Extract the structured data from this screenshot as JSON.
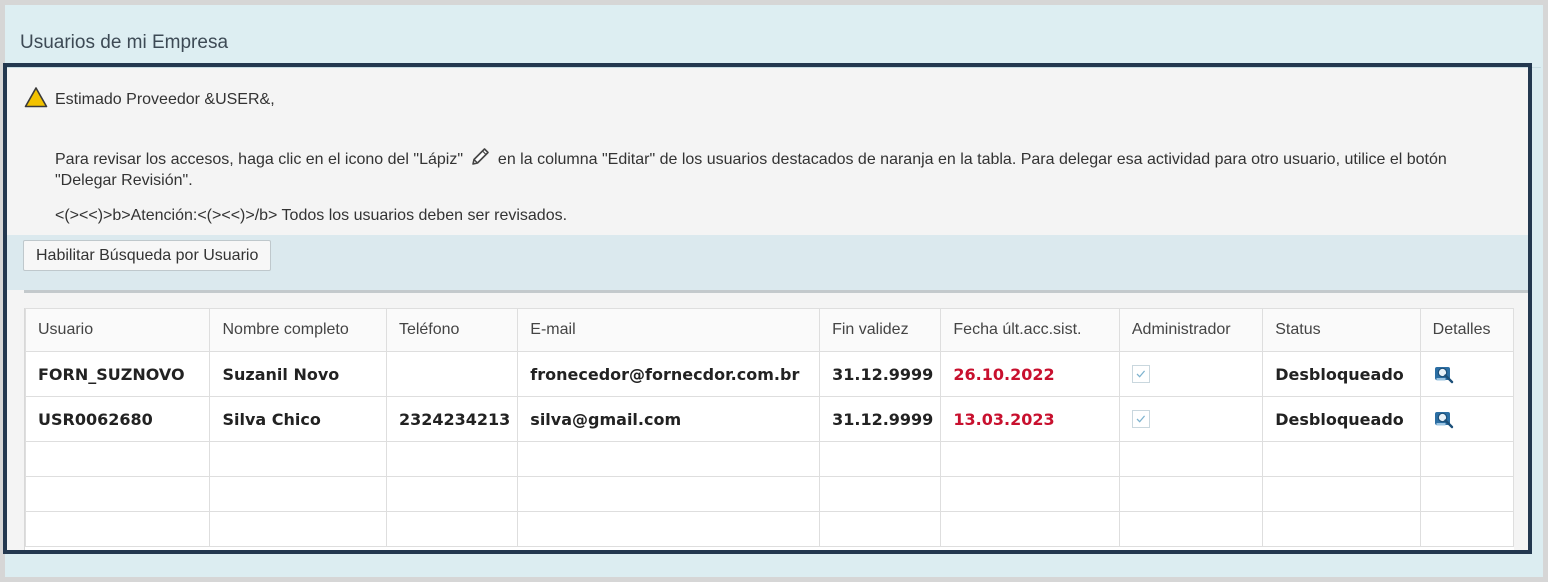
{
  "panel": {
    "title": "Usuarios de mi Empresa"
  },
  "message": {
    "greeting": "Estimado Proveedor &USER&,",
    "paragraph_before": "Para revisar los accesos, haga clic en el icono del \"Lápiz\"",
    "paragraph_after": "en la columna \"Editar\" de los usuarios destacados de naranja en la tabla. Para delegar esa actividad para otro usuario, utilice el botón \"Delegar Revisión\".",
    "note": "<(><<)>b>Atención:<(><<)>/b> Todos los usuarios deben ser revisados."
  },
  "toolbar": {
    "search_button": "Habilitar Búsqueda por Usuario"
  },
  "table": {
    "columns": [
      "Usuario",
      "Nombre completo",
      "Teléfono",
      "E-mail",
      "Fin validez",
      "Fecha últ.acc.sist.",
      "Administrador",
      "Status",
      "Detalles"
    ],
    "rows": [
      {
        "usuario": "FORN_SUZNOVO",
        "nombre": "Suzanil Novo",
        "telefono": "",
        "email": "fronecedor@fornecdor.com.br",
        "fin_validez": "31.12.9999",
        "fecha": "26.10.2022",
        "administrador": true,
        "status": "Desbloqueado"
      },
      {
        "usuario": "USR0062680",
        "nombre": "Silva Chico",
        "telefono": "2324234213",
        "email": "silva@gmail.com",
        "fin_validez": "31.12.9999",
        "fecha": "13.03.2023",
        "administrador": true,
        "status": "Desbloqueado"
      }
    ]
  },
  "colors": {
    "date_accent": "#c8102e",
    "highlight_border": "#23384f",
    "warning": "#f2c200"
  },
  "icons": {
    "warning": "warning-triangle-icon",
    "pencil": "pencil-icon",
    "details": "user-details-icon",
    "checkbox": "checkmark-icon"
  }
}
